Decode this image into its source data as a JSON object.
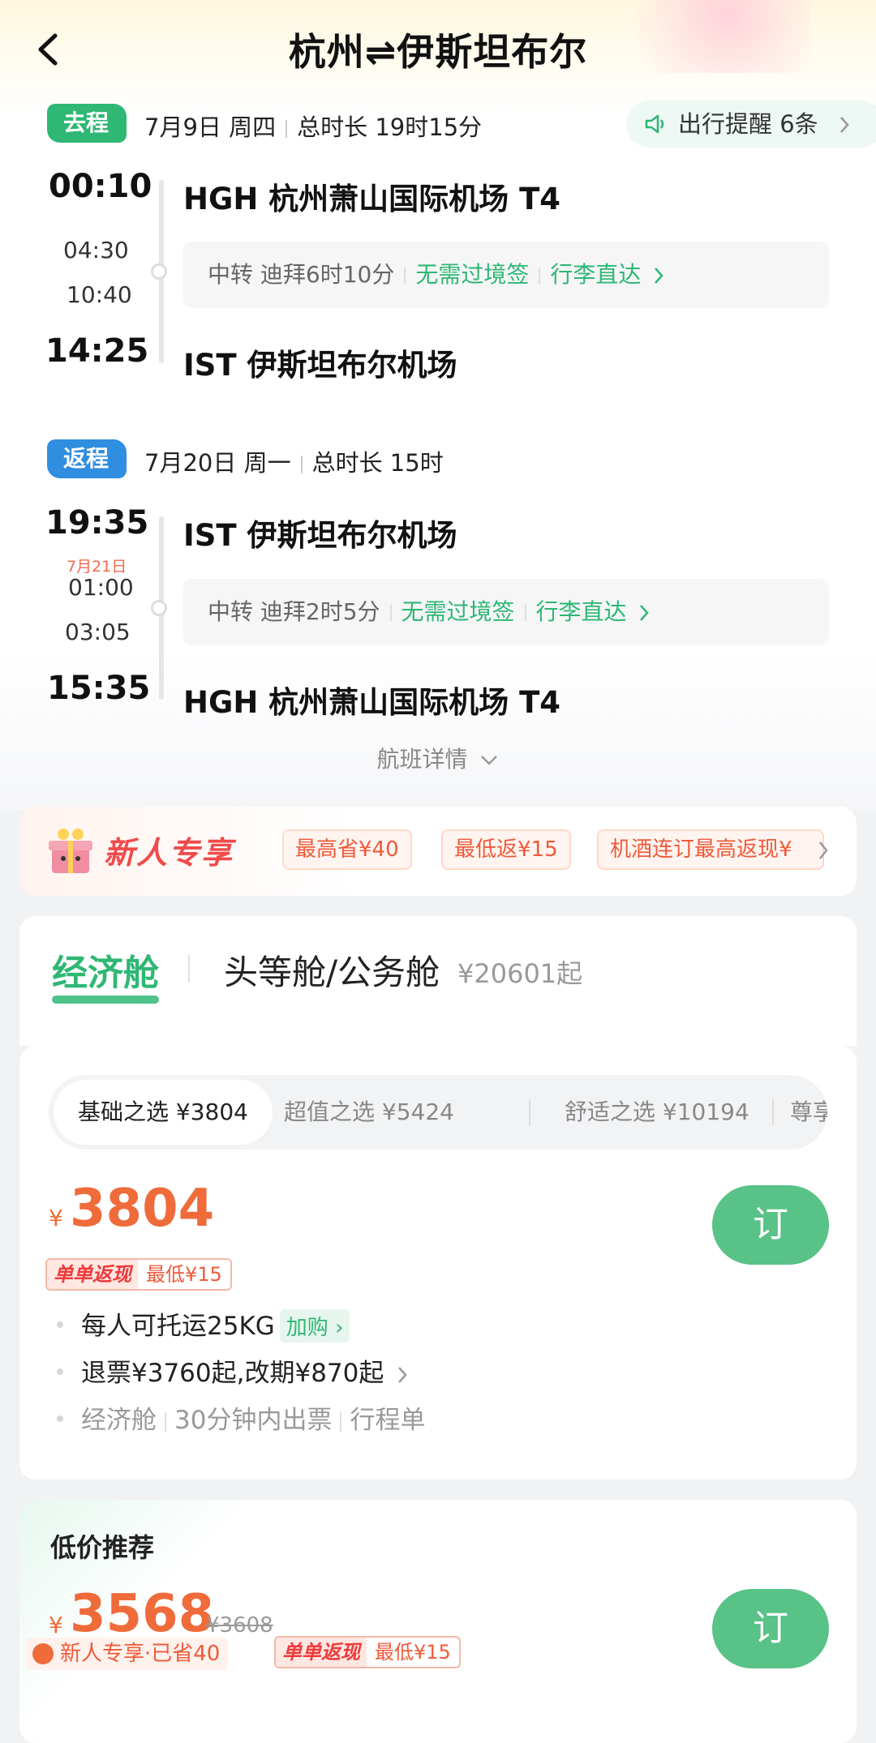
{
  "header": {
    "title": "杭州⇌伊斯坦布尔"
  },
  "outbound": {
    "tag": "去程",
    "date": "7月9日 周四",
    "duration": "总时长 19时15分",
    "reminder": "出行提醒 6条",
    "dep_time": "00:10",
    "stop_arr": "04:30",
    "stop_dep": "10:40",
    "arr_time": "14:25",
    "dep_airport": "HGH 杭州萧山国际机场 T4",
    "arr_airport": "IST 伊斯坦布尔机场",
    "transfer_label": "中转 迪拜6时10分",
    "visa": "无需过境签",
    "baggage": "行李直达"
  },
  "return": {
    "tag": "返程",
    "date": "7月20日 周一",
    "duration": "总时长 15时",
    "dep_time": "19:35",
    "next_day": "7月21日",
    "stop_arr": "01:00",
    "stop_dep": "03:05",
    "arr_time": "15:35",
    "dep_airport": "IST 伊斯坦布尔机场",
    "arr_airport": "HGH 杭州萧山国际机场 T4",
    "transfer_label": "中转 迪拜2时5分",
    "visa": "无需过境签",
    "baggage": "行李直达"
  },
  "flight_detail": "航班详情",
  "promo": {
    "title": "新人专享",
    "pills": [
      "最高省¥40",
      "最低返¥15",
      "机酒连订最高返现¥"
    ]
  },
  "cabins": {
    "active": "经济舱",
    "other": "头等舱/公务舱",
    "other_price": "¥20601起"
  },
  "fare_tabs": [
    {
      "label": "基础之选  ¥3804"
    },
    {
      "label": "超值之选  ¥5424"
    },
    {
      "label": "舒适之选  ¥10194"
    },
    {
      "label": "尊享"
    }
  ],
  "fare": {
    "currency": "¥",
    "price": "3804",
    "cashback_tag": "单单返现",
    "cashback_text": "最低¥15",
    "book": "订",
    "baggage": "每人可托运25KG",
    "add_on": "加购",
    "refund": "退票¥3760起,改期¥870起",
    "cabin": "经济舱",
    "ticketing": "30分钟内出票",
    "itinerary": "行程单"
  },
  "low_price": {
    "title": "低价推荐",
    "currency": "¥",
    "price": "3568",
    "original": "¥3608",
    "saved": "新人专享·已省40",
    "cashback_tag": "单单返现",
    "cashback_text": "最低¥15",
    "book": "订"
  },
  "colors": {
    "green": "#2fb774",
    "blue": "#2f8ee0",
    "orange": "#ef6b3a",
    "book_button": "#58c287"
  },
  "icons": [
    "back-arrow-icon",
    "speaker-icon",
    "chevron-right-icon",
    "chevron-down-icon",
    "gift-box-icon"
  ]
}
